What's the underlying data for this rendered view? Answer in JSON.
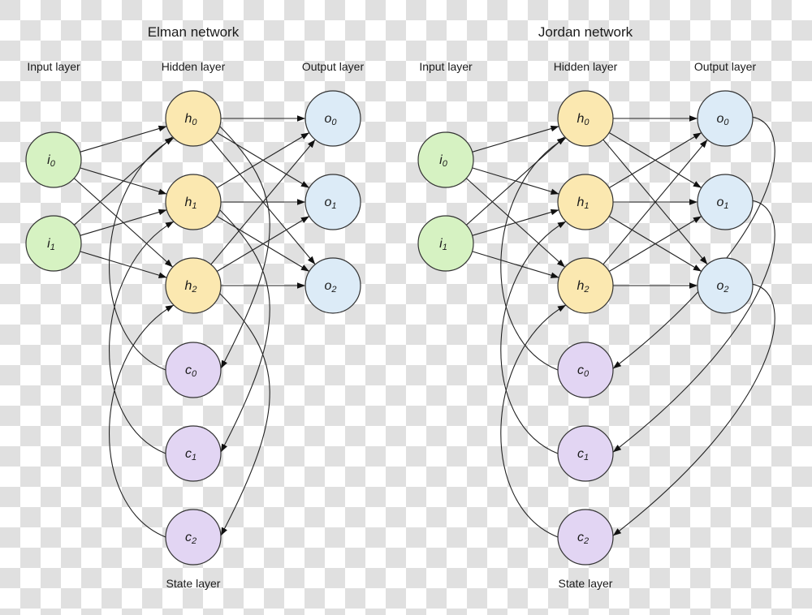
{
  "colors": {
    "input": "#d6f2c2",
    "hidden": "#fbe8b0",
    "output": "#dcebf7",
    "state": "#e2d5f3",
    "edge": "#222222",
    "background_checker": "#e0e0e0"
  },
  "networks": [
    {
      "id": "elman",
      "title": "Elman network",
      "labels": {
        "input": "Input layer",
        "hidden": "Hidden layer",
        "output": "Output layer",
        "state": "State layer"
      },
      "nodes": {
        "input": [
          {
            "base": "i",
            "sub": "0"
          },
          {
            "base": "i",
            "sub": "1"
          }
        ],
        "hidden": [
          {
            "base": "h",
            "sub": "0"
          },
          {
            "base": "h",
            "sub": "1"
          },
          {
            "base": "h",
            "sub": "2"
          }
        ],
        "output": [
          {
            "base": "o",
            "sub": "0"
          },
          {
            "base": "o",
            "sub": "1"
          },
          {
            "base": "o",
            "sub": "2"
          }
        ],
        "state": [
          {
            "base": "c",
            "sub": "0"
          },
          {
            "base": "c",
            "sub": "1"
          },
          {
            "base": "c",
            "sub": "2"
          }
        ]
      },
      "connections": {
        "input_to_hidden": "full",
        "hidden_to_output": "full",
        "feedback_source": "hidden",
        "state_to_hidden": "one-to-one"
      }
    },
    {
      "id": "jordan",
      "title": "Jordan network",
      "labels": {
        "input": "Input layer",
        "hidden": "Hidden layer",
        "output": "Output layer",
        "state": "State layer"
      },
      "nodes": {
        "input": [
          {
            "base": "i",
            "sub": "0"
          },
          {
            "base": "i",
            "sub": "1"
          }
        ],
        "hidden": [
          {
            "base": "h",
            "sub": "0"
          },
          {
            "base": "h",
            "sub": "1"
          },
          {
            "base": "h",
            "sub": "2"
          }
        ],
        "output": [
          {
            "base": "o",
            "sub": "0"
          },
          {
            "base": "o",
            "sub": "1"
          },
          {
            "base": "o",
            "sub": "2"
          }
        ],
        "state": [
          {
            "base": "c",
            "sub": "0"
          },
          {
            "base": "c",
            "sub": "1"
          },
          {
            "base": "c",
            "sub": "2"
          }
        ]
      },
      "connections": {
        "input_to_hidden": "full",
        "hidden_to_output": "full",
        "feedback_source": "output",
        "state_to_hidden": "one-to-one"
      }
    }
  ]
}
